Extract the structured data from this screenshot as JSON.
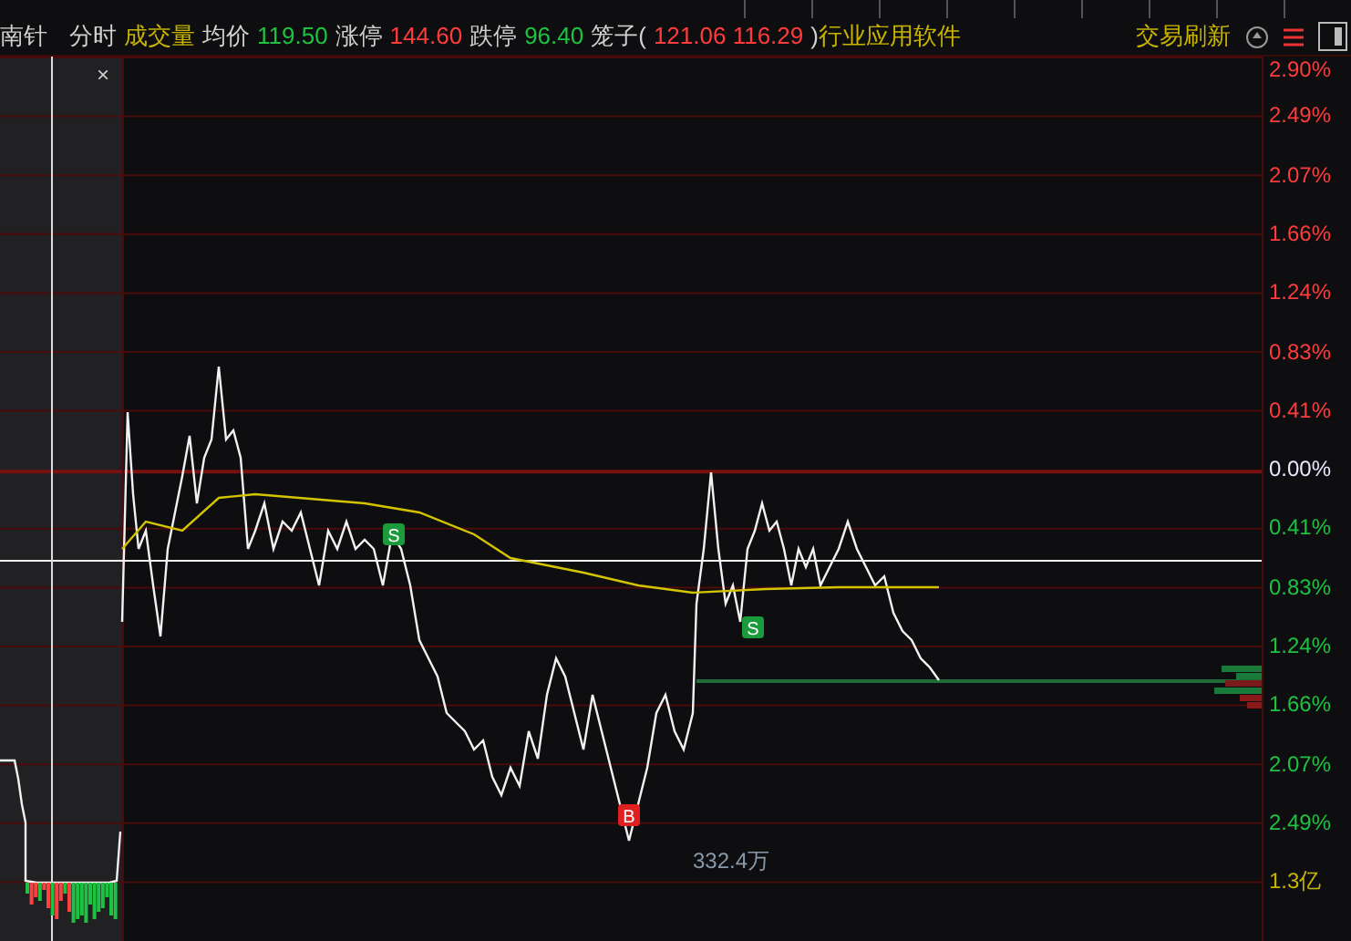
{
  "header": {
    "title": "南针",
    "items": [
      {
        "kind": "label",
        "text": "分时"
      },
      {
        "kind": "volume",
        "text": "成交量"
      },
      {
        "kind": "label",
        "text": "均价"
      },
      {
        "kind": "down",
        "text": "119.50"
      },
      {
        "kind": "label",
        "text": "涨停"
      },
      {
        "kind": "up",
        "text": "144.60"
      },
      {
        "kind": "label",
        "text": "跌停"
      },
      {
        "kind": "down",
        "text": "96.40"
      },
      {
        "kind": "label",
        "text": "笼子("
      },
      {
        "kind": "up",
        "text": "121.06 116.29"
      },
      {
        "kind": "label",
        "text": ")"
      },
      {
        "kind": "volume",
        "text": "行业应用软件"
      }
    ],
    "refresh": "交易刷新"
  },
  "chart": {
    "close": "×",
    "volume_label": "332.4万",
    "markers": [
      {
        "kind": "sell",
        "text": "S"
      },
      {
        "kind": "sell",
        "text": "S"
      },
      {
        "kind": "buy",
        "text": "B"
      }
    ],
    "axis": [
      {
        "kind": "up",
        "text": "2.90%"
      },
      {
        "kind": "up",
        "text": "2.49%"
      },
      {
        "kind": "up",
        "text": "2.07%"
      },
      {
        "kind": "up",
        "text": "1.66%"
      },
      {
        "kind": "up",
        "text": "1.24%"
      },
      {
        "kind": "up",
        "text": "0.83%"
      },
      {
        "kind": "up",
        "text": "0.41%"
      },
      {
        "kind": "flat",
        "text": "0.00%"
      },
      {
        "kind": "down",
        "text": "0.41%"
      },
      {
        "kind": "down",
        "text": "0.83%"
      },
      {
        "kind": "down",
        "text": "1.24%"
      },
      {
        "kind": "down",
        "text": "1.66%"
      },
      {
        "kind": "down",
        "text": "2.07%"
      },
      {
        "kind": "down",
        "text": "2.49%"
      },
      {
        "kind": "volume",
        "text": "1.3亿"
      }
    ]
  }
}
